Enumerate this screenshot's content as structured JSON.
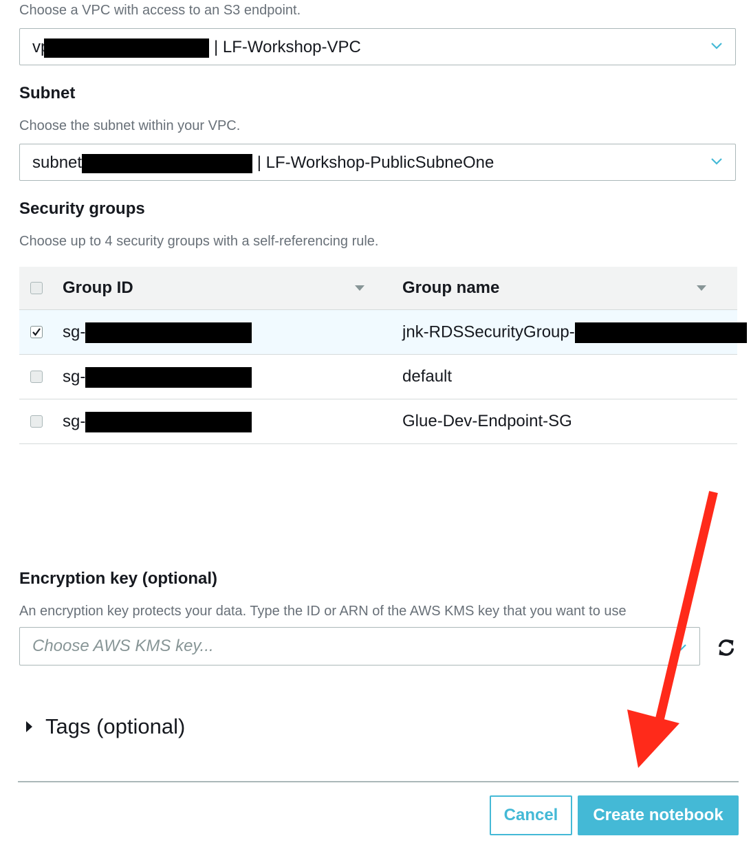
{
  "vpc": {
    "help": "Choose a VPC with access to an S3 endpoint.",
    "prefix": "vpc-",
    "suffix": "| LF-Workshop-VPC"
  },
  "subnet": {
    "label": "Subnet",
    "help": "Choose the subnet within your VPC.",
    "prefix": "subnet",
    "suffix": "| LF-Workshop-PublicSubneOne"
  },
  "security_groups": {
    "label": "Security groups",
    "help": "Choose up to 4 security groups with a self-referencing rule.",
    "columns": [
      "Group ID",
      "Group name"
    ],
    "rows": [
      {
        "id": "sg-",
        "name": "jnk-RDSSecurityGroup-",
        "checked": true
      },
      {
        "id": "sg-",
        "name": "default",
        "checked": false
      },
      {
        "id": "sg-",
        "name": "Glue-Dev-Endpoint-SG",
        "checked": false
      }
    ]
  },
  "encryption": {
    "label": "Encryption key (optional)",
    "help": "An encryption key protects your data. Type the ID or ARN of the AWS KMS key that you want to use",
    "placeholder": "Choose AWS KMS key..."
  },
  "tags": {
    "label": "Tags (optional)"
  },
  "buttons": {
    "cancel": "Cancel",
    "create": "Create notebook"
  },
  "colors": {
    "accent": "#44b9d6",
    "button_primary": "#44b9d6",
    "arrow": "#ff2a1a"
  }
}
